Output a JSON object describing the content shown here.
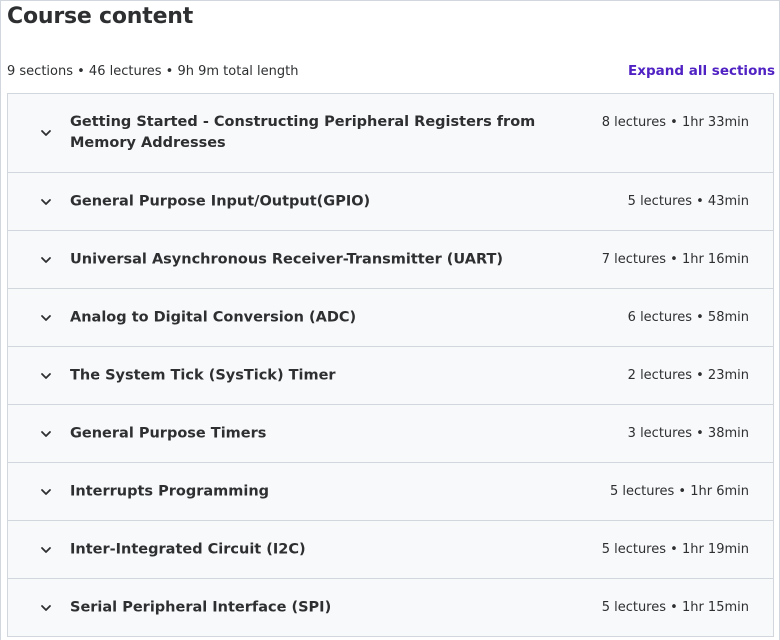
{
  "header": {
    "title": "Course content",
    "summary": "9 sections • 46 lectures • 9h 9m total length",
    "expand_label": "Expand all sections"
  },
  "sections": [
    {
      "title": "Getting Started - Constructing Peripheral Registers from Memory Addresses",
      "info": "8 lectures • 1hr 33min"
    },
    {
      "title": "General Purpose Input/Output(GPIO)",
      "info": "5 lectures • 43min"
    },
    {
      "title": "Universal Asynchronous Receiver-Transmitter (UART)",
      "info": "7 lectures • 1hr 16min"
    },
    {
      "title": "Analog to Digital Conversion (ADC)",
      "info": "6 lectures • 58min"
    },
    {
      "title": "The System Tick (SysTick) Timer",
      "info": "2 lectures • 23min"
    },
    {
      "title": "General Purpose Timers",
      "info": "3 lectures • 38min"
    },
    {
      "title": "Interrupts Programming",
      "info": "5 lectures • 1hr 6min"
    },
    {
      "title": "Inter-Integrated Circuit (I2C)",
      "info": "5 lectures • 1hr 19min"
    },
    {
      "title": "Serial Peripheral Interface (SPI)",
      "info": "5 lectures • 1hr 15min"
    }
  ],
  "icons": {
    "section_toggle": "chevron-down-icon"
  },
  "colors": {
    "accent": "#5022c3",
    "section_bg": "#f7f9fa",
    "border": "#d1d7dc",
    "text": "#2d2f31"
  }
}
